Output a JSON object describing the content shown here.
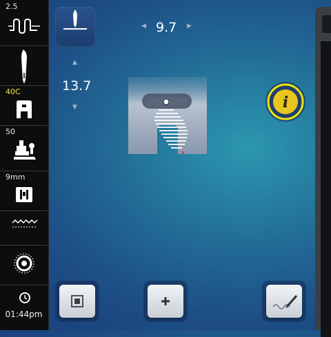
{
  "sidebar": {
    "stitch_length": "2.5",
    "presser_foot": "40C",
    "presser_pressure": "50",
    "stitch_plate": "9mm",
    "clock": "01:44pm"
  },
  "stitch": {
    "width": "9.7",
    "length": "13.7"
  },
  "icons": {
    "needle_position": "needle-position-icon",
    "info": "info-icon",
    "single_stitch": "single-stitch-icon",
    "add": "add-icon",
    "stitch_editor": "stitch-editor-icon"
  },
  "colors": {
    "accent": "#f0e400",
    "info_badge": "#e8c61e"
  }
}
